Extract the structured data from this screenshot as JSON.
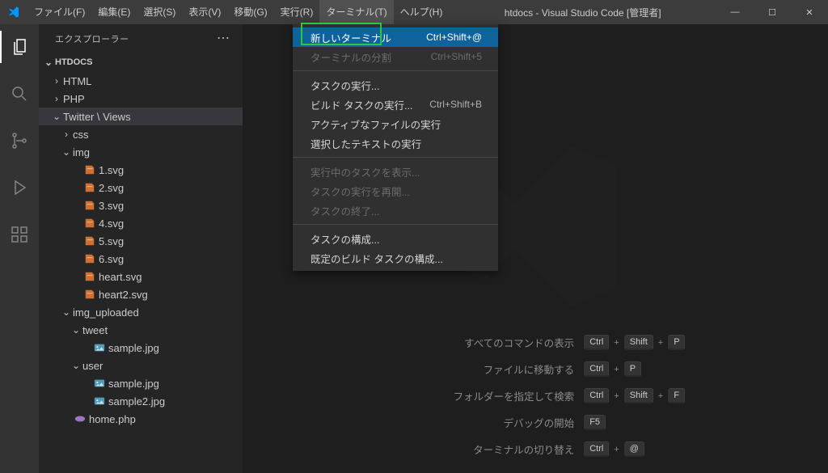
{
  "titlebar": {
    "title": "htdocs - Visual Studio Code [管理者]",
    "menu": [
      {
        "label": "ファイル(F)"
      },
      {
        "label": "編集(E)"
      },
      {
        "label": "選択(S)"
      },
      {
        "label": "表示(V)"
      },
      {
        "label": "移動(G)"
      },
      {
        "label": "実行(R)"
      },
      {
        "label": "ターミナル(T)",
        "open": true
      },
      {
        "label": "ヘルプ(H)"
      }
    ]
  },
  "dropdown": [
    {
      "type": "item",
      "label": "新しいターミナル",
      "shortcut": "Ctrl+Shift+@",
      "highlight": true
    },
    {
      "type": "item",
      "label": "ターミナルの分割",
      "shortcut": "Ctrl+Shift+5",
      "disabled": true
    },
    {
      "type": "sep"
    },
    {
      "type": "item",
      "label": "タスクの実行..."
    },
    {
      "type": "item",
      "label": "ビルド タスクの実行...",
      "shortcut": "Ctrl+Shift+B"
    },
    {
      "type": "item",
      "label": "アクティブなファイルの実行"
    },
    {
      "type": "item",
      "label": "選択したテキストの実行"
    },
    {
      "type": "sep"
    },
    {
      "type": "item",
      "label": "実行中のタスクを表示...",
      "disabled": true
    },
    {
      "type": "item",
      "label": "タスクの実行を再開...",
      "disabled": true
    },
    {
      "type": "item",
      "label": "タスクの終了...",
      "disabled": true
    },
    {
      "type": "sep"
    },
    {
      "type": "item",
      "label": "タスクの構成..."
    },
    {
      "type": "item",
      "label": "既定のビルド タスクの構成..."
    }
  ],
  "sidebar": {
    "title": "エクスプローラー",
    "root": "HTDOCS",
    "tree": [
      {
        "depth": 0,
        "type": "folder",
        "expand": "right",
        "label": "HTML"
      },
      {
        "depth": 0,
        "type": "folder",
        "expand": "right",
        "label": "PHP"
      },
      {
        "depth": 0,
        "type": "breadcrumb",
        "expand": "down",
        "label": "Twitter",
        "sub": "Views",
        "selected": true
      },
      {
        "depth": 1,
        "type": "folder",
        "expand": "right",
        "label": "css"
      },
      {
        "depth": 1,
        "type": "folder",
        "expand": "down",
        "label": "img"
      },
      {
        "depth": 2,
        "type": "file",
        "icon": "svg",
        "label": "1.svg"
      },
      {
        "depth": 2,
        "type": "file",
        "icon": "svg",
        "label": "2.svg"
      },
      {
        "depth": 2,
        "type": "file",
        "icon": "svg",
        "label": "3.svg"
      },
      {
        "depth": 2,
        "type": "file",
        "icon": "svg",
        "label": "4.svg"
      },
      {
        "depth": 2,
        "type": "file",
        "icon": "svg",
        "label": "5.svg"
      },
      {
        "depth": 2,
        "type": "file",
        "icon": "svg",
        "label": "6.svg"
      },
      {
        "depth": 2,
        "type": "file",
        "icon": "svg",
        "label": "heart.svg"
      },
      {
        "depth": 2,
        "type": "file",
        "icon": "svg",
        "label": "heart2.svg"
      },
      {
        "depth": 1,
        "type": "folder",
        "expand": "down",
        "label": "img_uploaded"
      },
      {
        "depth": 2,
        "type": "folder",
        "expand": "down",
        "label": "tweet"
      },
      {
        "depth": 3,
        "type": "file",
        "icon": "img",
        "label": "sample.jpg"
      },
      {
        "depth": 2,
        "type": "folder",
        "expand": "down",
        "label": "user"
      },
      {
        "depth": 3,
        "type": "file",
        "icon": "img",
        "label": "sample.jpg"
      },
      {
        "depth": 3,
        "type": "file",
        "icon": "img",
        "label": "sample2.jpg"
      },
      {
        "depth": 1,
        "type": "file",
        "icon": "php",
        "label": "home.php"
      }
    ]
  },
  "shortcuts": [
    {
      "label": "すべてのコマンドの表示",
      "keys": [
        "Ctrl",
        "Shift",
        "P"
      ]
    },
    {
      "label": "ファイルに移動する",
      "keys": [
        "Ctrl",
        "P"
      ]
    },
    {
      "label": "フォルダーを指定して検索",
      "keys": [
        "Ctrl",
        "Shift",
        "F"
      ]
    },
    {
      "label": "デバッグの開始",
      "keys": [
        "F5"
      ]
    },
    {
      "label": "ターミナルの切り替え",
      "keys": [
        "Ctrl",
        "@"
      ]
    }
  ]
}
